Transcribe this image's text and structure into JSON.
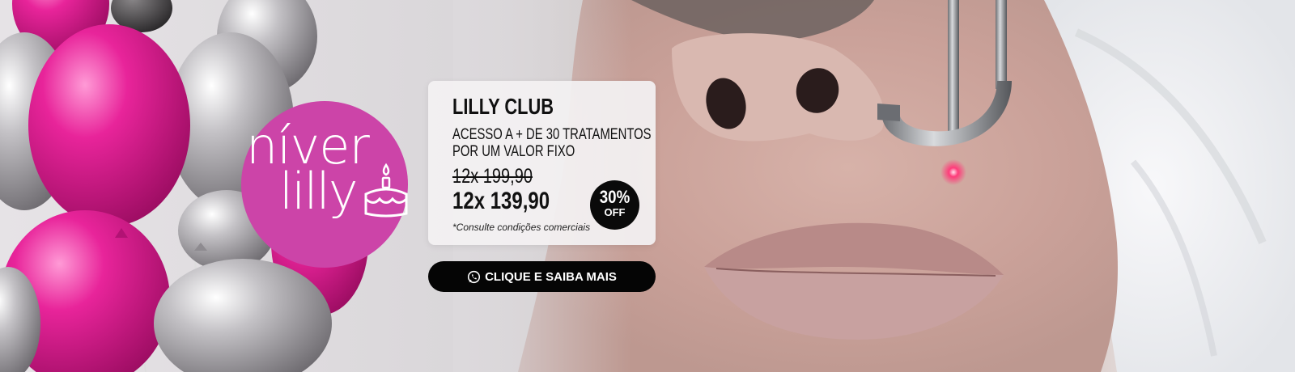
{
  "hero_image": "face laser treatment photo",
  "brand": {
    "niver": "níver",
    "lilly": "lilly"
  },
  "card": {
    "title": "LILLY CLUB",
    "description": "ACESSO A + DE 30 TRATAMENTOS POR UM VALOR FIXO",
    "old_price": "12x 199,90",
    "new_price": "12x 139,90",
    "note": "*Consulte condições comerciais"
  },
  "badge": {
    "percent": "30%",
    "off": "OFF"
  },
  "cta": {
    "label": "CLIQUE E SAIBA MAIS",
    "icon": "whatsapp-icon"
  },
  "colors": {
    "brand_pink": "#cc44a8",
    "cta_background": "#050505",
    "balloon_pink": "#e0198f",
    "balloon_silver": "#b9b6ba"
  }
}
